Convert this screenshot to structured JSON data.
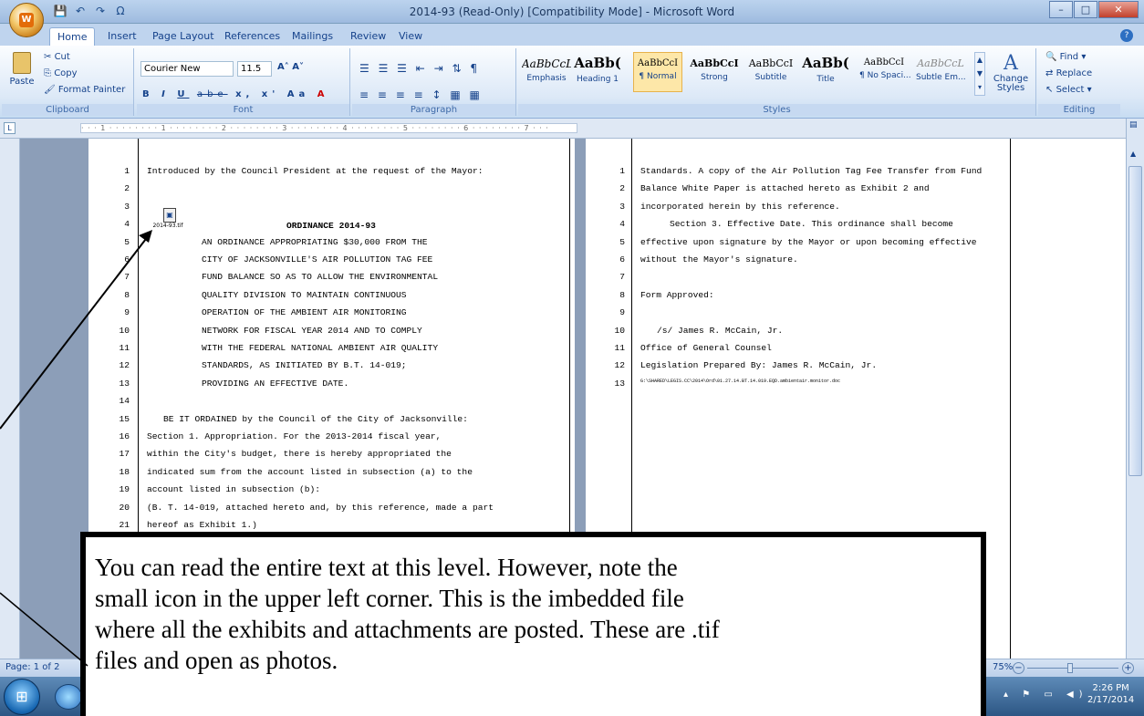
{
  "window": {
    "title": "2014-93 (Read-Only) [Compatibility Mode] - Microsoft Word",
    "controls": [
      "–",
      "□",
      "✕"
    ]
  },
  "ribbon_tabs": [
    "Home",
    "Insert",
    "Page Layout",
    "References",
    "Mailings",
    "Review",
    "View"
  ],
  "clipboard": {
    "paste": "Paste",
    "cut": "Cut",
    "copy": "Copy",
    "format_painter": "Format Painter",
    "label": "Clipboard"
  },
  "font": {
    "name": "Courier New",
    "size": "11.5",
    "label": "Font",
    "buttons": [
      "B",
      "I",
      "U",
      "abe",
      "x,",
      "x'",
      "Aa",
      "A"
    ]
  },
  "paragraph": {
    "label": "Paragraph"
  },
  "styles": {
    "label": "Styles",
    "items": [
      {
        "sample": "AaBbCcL",
        "name": "Emphasis"
      },
      {
        "sample": "AaBb(",
        "name": "Heading 1"
      },
      {
        "sample": "AaBbCcI",
        "name": "¶ Normal"
      },
      {
        "sample": "AaBbCcI",
        "name": "Strong"
      },
      {
        "sample": "AaBbCcI",
        "name": "Subtitle"
      },
      {
        "sample": "AaBb(",
        "name": "Title"
      },
      {
        "sample": "AaBbCcI",
        "name": "¶ No Spaci..."
      },
      {
        "sample": "AaBbCcL",
        "name": "Subtle Em..."
      }
    ],
    "change_styles": "Change Styles"
  },
  "editing": {
    "find": "Find",
    "replace": "Replace",
    "select": "Select",
    "label": "Editing"
  },
  "embedded_file": {
    "caption": "2014-93.tif"
  },
  "page1": {
    "heading_intro": "Introduced by the Council President at the request of the Mayor:",
    "ordinance_title": "ORDINANCE 2014-93",
    "lines": [
      {
        "n": "1",
        "text": "Introduced by the Council President at the request of the Mayor:"
      },
      {
        "n": "2",
        "text": ""
      },
      {
        "n": "3",
        "text": ""
      },
      {
        "n": "4",
        "text": ""
      },
      {
        "n": "5",
        "text": "AN ORDINANCE APPROPRIATING $30,000 FROM THE"
      },
      {
        "n": "6",
        "text": "CITY OF JACKSONVILLE'S AIR POLLUTION TAG FEE"
      },
      {
        "n": "7",
        "text": "FUND BALANCE SO AS TO ALLOW THE ENVIRONMENTAL"
      },
      {
        "n": "8",
        "text": "QUALITY  DIVISION  TO  MAINTAIN  CONTINUOUS"
      },
      {
        "n": "9",
        "text": "OPERATION  OF  THE  AMBIENT  AIR  MONITORING"
      },
      {
        "n": "10",
        "text": "NETWORK FOR FISCAL YEAR 2014 AND TO COMPLY"
      },
      {
        "n": "11",
        "text": "WITH THE FEDERAL NATIONAL AMBIENT AIR QUALITY"
      },
      {
        "n": "12",
        "text": "STANDARDS,  AS  INITIATED  BY  B.T.  14-019;"
      },
      {
        "n": "13",
        "text": "PROVIDING AN EFFECTIVE DATE."
      },
      {
        "n": "14",
        "text": ""
      },
      {
        "n": "15",
        "text": "BE IT ORDAINED by the Council of the City of Jacksonville:"
      },
      {
        "n": "16",
        "text": "Section 1.     Appropriation. For the 2013-2014 fiscal year,"
      },
      {
        "n": "17",
        "text": "within the City's budget, there is hereby appropriated the"
      },
      {
        "n": "18",
        "text": "indicated sum from the account listed in subsection (a) to the"
      },
      {
        "n": "19",
        "text": "account listed in subsection (b):"
      },
      {
        "n": "20",
        "text": "(B. T. 14-019, attached hereto and, by this reference, made a part"
      },
      {
        "n": "21",
        "text": "hereof as Exhibit 1.)"
      }
    ]
  },
  "page2": {
    "lines": [
      {
        "n": "1",
        "text": "Standards. A copy of the Air Pollution Tag Fee Transfer from Fund"
      },
      {
        "n": "2",
        "text": "Balance  White  Paper  is  attached  hereto  as  Exhibit 2  and"
      },
      {
        "n": "3",
        "text": "incorporated herein by this reference."
      },
      {
        "n": "4",
        "text": "Section 3.     Effective Date. This ordinance shall become"
      },
      {
        "n": "5",
        "text": "effective upon signature by the Mayor or upon becoming effective"
      },
      {
        "n": "6",
        "text": "without the Mayor's signature."
      },
      {
        "n": "7",
        "text": ""
      },
      {
        "n": "8",
        "text": "Form Approved:"
      },
      {
        "n": "9",
        "text": ""
      },
      {
        "n": "10",
        "text": "/s/    James R. McCain, Jr."
      },
      {
        "n": "11",
        "text": "Office of General Counsel"
      },
      {
        "n": "12",
        "text": "Legislation Prepared By:  James R. McCain, Jr."
      },
      {
        "n": "13",
        "text": "G:\\SHARED\\LEGIS.CC\\2014\\Ord\\01.27.14.BT.14.019.EQD.ambientair.monitor.doc"
      }
    ]
  },
  "statusbar": {
    "page": "Page: 1 of 2",
    "zoom": "75%"
  },
  "taskbar": {
    "time": "2:26 PM",
    "date": "2/17/2014"
  },
  "annotation": {
    "lines": [
      "You can read the entire text at this level. However, note the",
      "small icon in the upper left corner. This is the imbedded file",
      "where all the exhibits and attachments are posted. These are .tif",
      "files and open as photos."
    ]
  }
}
